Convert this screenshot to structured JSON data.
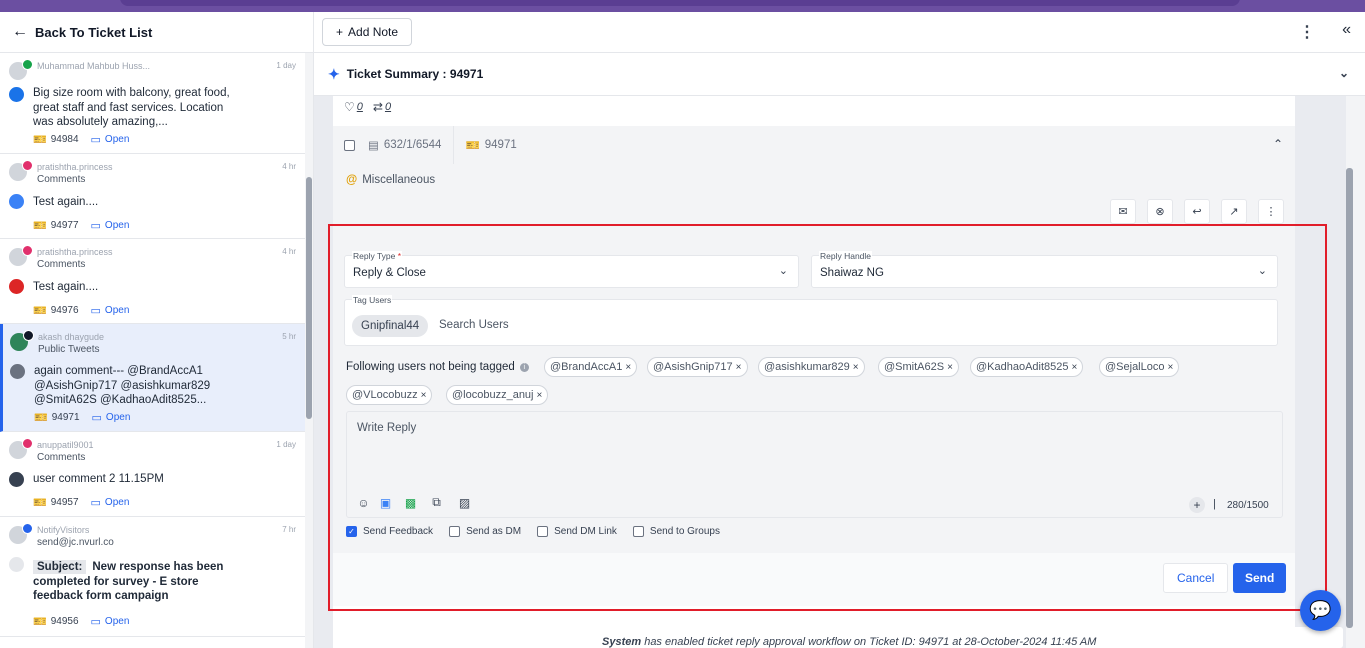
{
  "back": {
    "label": "Back To Ticket List"
  },
  "tickets": [
    {
      "user": "Muhammad Mahbub Huss...",
      "channel": "",
      "time": "1 day",
      "message": "Big size room with balcony, great food, great staff and fast services. Location was absolutely amazing,...",
      "id": "94984",
      "status": "Open",
      "icon": "bing-icon",
      "source_color": "#1a73e8",
      "badge_color": "#16a34a"
    },
    {
      "user": "pratishtha.princess",
      "channel": "Comments",
      "time": "4 hr",
      "message": "Test again....",
      "id": "94977",
      "status": "Open",
      "icon": "instagram-icon",
      "source_color": "#3b82f6",
      "badge_color": "#e1306c"
    },
    {
      "user": "pratishtha.princess",
      "channel": "Comments",
      "time": "4 hr",
      "message": "Test again....",
      "id": "94976",
      "status": "Open",
      "icon": "instagram-icon",
      "source_color": "#dc2626",
      "badge_color": "#e1306c"
    },
    {
      "user": "akash dhaygude",
      "channel": "Public Tweets",
      "time": "5 hr",
      "message": "again comment--- @BrandAccA1 @AsishGnip717 @asishkumar829 @SmitA62S @KadhaoAdit8525...",
      "id": "94971",
      "status": "Open",
      "icon": "x-icon",
      "source_color": "#6b7280",
      "badge_color": "#111827"
    },
    {
      "user": "anuppatil9001",
      "channel": "Comments",
      "time": "1 day",
      "message": "user comment 2 11.15PM",
      "id": "94957",
      "status": "Open",
      "icon": "instagram-icon",
      "source_color": "#374151",
      "badge_color": "#e1306c"
    },
    {
      "user": "NotifyVisitors",
      "channel": "send@jc.nvurl.co",
      "time": "7 hr",
      "subject_label": "Subject:",
      "message": "New response has been completed for survey - E store feedback form campaign",
      "id": "94956",
      "status": "Open",
      "icon": "email-icon",
      "source_color": "#e5e7eb",
      "badge_color": "#2563eb"
    }
  ],
  "header": {
    "add_note": "Add Note"
  },
  "summary": {
    "title": "Ticket Summary : 94971"
  },
  "post": {
    "likes": "0",
    "retweets": "0",
    "conversation": "632/1/6544",
    "ticket_id": "94971",
    "category": "Miscellaneous"
  },
  "reply": {
    "reply_type_label": "Reply Type",
    "reply_type_required": "*",
    "reply_type_value": "Reply & Close",
    "reply_handle_label": "Reply Handle",
    "reply_handle_value": "Shaiwaz NG",
    "tag_users_label": "Tag Users",
    "tagged_user": "Gnipfinal44",
    "search_placeholder": "Search Users",
    "not_tagged_label": "Following users not being tagged",
    "not_tagged": [
      "@BrandAccA1",
      "@AsishGnip717",
      "@asishkumar829",
      "@SmitA62S",
      "@KadhaoAdit8525",
      "@SejalLoco",
      "@VLocobuzz",
      "@locobuzz_anuj"
    ],
    "placeholder": "Write Reply",
    "char_count": "280/1500",
    "options": [
      {
        "label": "Send Feedback",
        "checked": true
      },
      {
        "label": "Send as DM",
        "checked": false
      },
      {
        "label": "Send DM Link",
        "checked": false
      },
      {
        "label": "Send to Groups",
        "checked": false
      }
    ],
    "cancel": "Cancel",
    "send": "Send"
  },
  "system_message": {
    "actor": "System",
    "text": " has enabled ticket reply approval workflow on Ticket ID: 94971 at 28-October-2024 11:45 AM"
  },
  "colors": {
    "accent": "#2563eb",
    "highlight": "#e11d2a",
    "topbar": "#6b4fa1"
  }
}
